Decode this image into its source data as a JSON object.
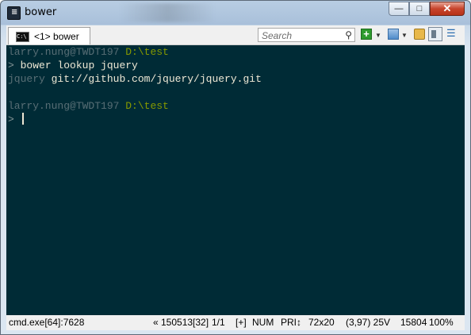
{
  "window": {
    "title": "bower"
  },
  "caption": {
    "minimize": "—",
    "maximize": "□",
    "close": "✕"
  },
  "tab": {
    "label": "<1> bower"
  },
  "search": {
    "placeholder": "Search"
  },
  "console": {
    "lines": [
      {
        "user": "larry.nung@TWDT197",
        "path": "D:\\test"
      },
      {
        "prompt": ">",
        "command": "bower lookup jquery"
      },
      {
        "name": "jquery",
        "url": "git://github.com/jquery/jquery.git"
      },
      {
        "user": "larry.nung@TWDT197",
        "path": "D:\\test"
      },
      {
        "prompt": ">"
      }
    ]
  },
  "status": {
    "process": "cmd.exe[64]:7628",
    "buffer": "« 150513[32]",
    "pages": "1/1",
    "mode": "[+]",
    "numlock": "NUM",
    "priority": "PRI↕",
    "size": "72x20",
    "cursor": "(3,97) 25V",
    "pid": "15804",
    "zoom": "100%"
  },
  "colors": {
    "console_bg": "#002b36",
    "path_green": "#859900",
    "text_gray": "#586e75"
  },
  "icons": [
    "app-icon",
    "console-tab-icon",
    "search-icon",
    "new-console-icon",
    "view-icon",
    "lock-icon",
    "split-icon",
    "menu-icon"
  ]
}
